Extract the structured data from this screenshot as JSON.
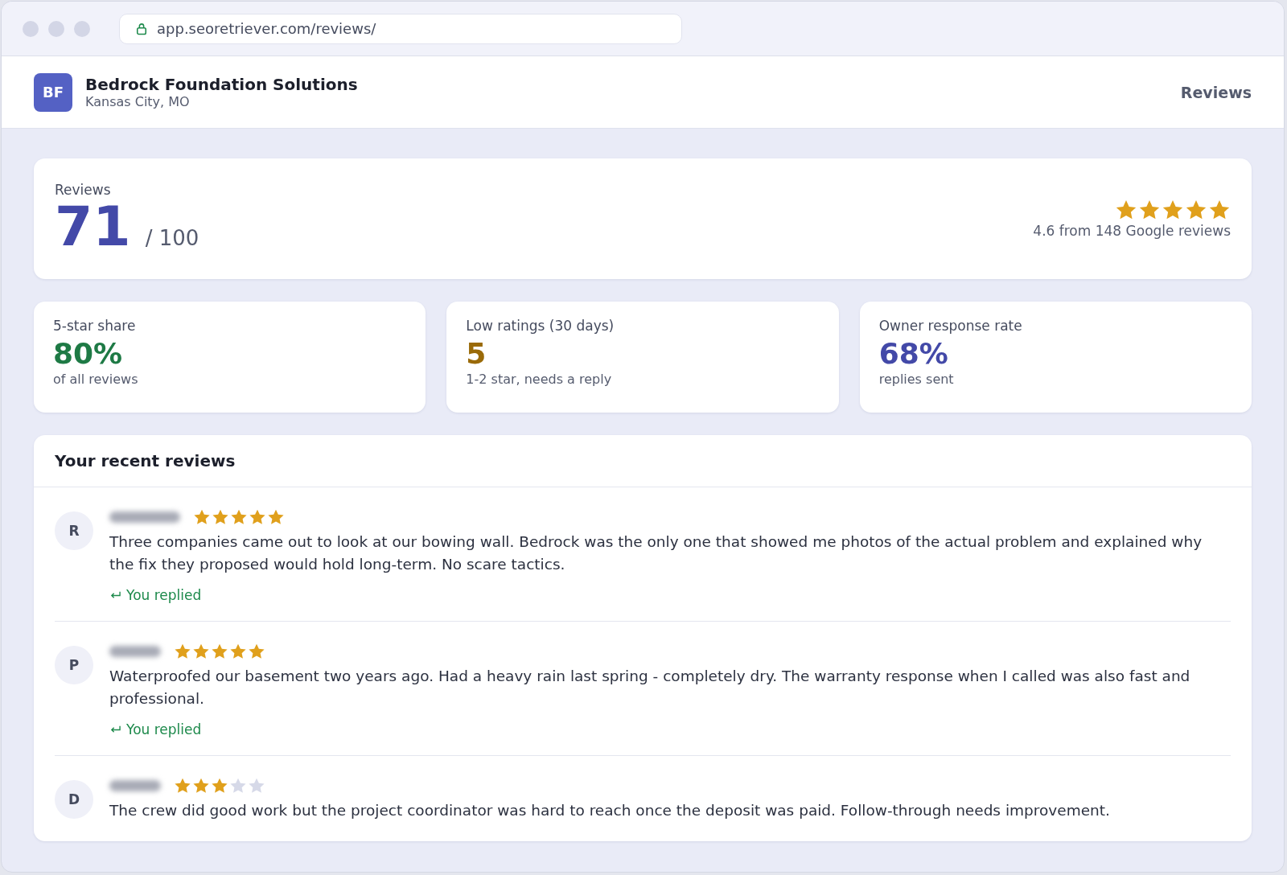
{
  "browser": {
    "url": "app.seoretriever.com/reviews/"
  },
  "header": {
    "logo": "BF",
    "business": "Bedrock Foundation Solutions",
    "location": "Kansas City, MO",
    "nav": "Reviews"
  },
  "score": {
    "label": "Reviews",
    "value": "71",
    "max": "/ 100",
    "stars": 5,
    "summary": "4.6 from 148 Google reviews"
  },
  "metrics": [
    {
      "label": "5-star share",
      "value": "80%",
      "color": "#1e7a45",
      "note": "of all reviews"
    },
    {
      "label": "Low ratings (30 days)",
      "value": "5",
      "color": "#9a6a08",
      "note": "1-2 star, needs a reply"
    },
    {
      "label": "Owner response rate",
      "value": "68%",
      "color": "#4349a8",
      "note": "replies sent"
    }
  ],
  "recent": {
    "title": "Your recent reviews",
    "reviews": [
      {
        "initial": "R",
        "stars": 5,
        "text": "Three companies came out to look at our bowing wall. Bedrock was the only one that showed me photos of the actual problem and explained why the fix they proposed would hold long-term. No scare tactics.",
        "replied": true,
        "reply_label": "You replied"
      },
      {
        "initial": "P",
        "stars": 5,
        "text": "Waterproofed our basement two years ago. Had a heavy rain last spring - completely dry. The warranty response when I called was also fast and professional.",
        "replied": true,
        "reply_label": "You replied"
      },
      {
        "initial": "D",
        "stars": 3,
        "text": "The crew did good work but the project coordinator was hard to reach once the deposit was paid. Follow-through needs improvement.",
        "replied": false
      }
    ]
  }
}
